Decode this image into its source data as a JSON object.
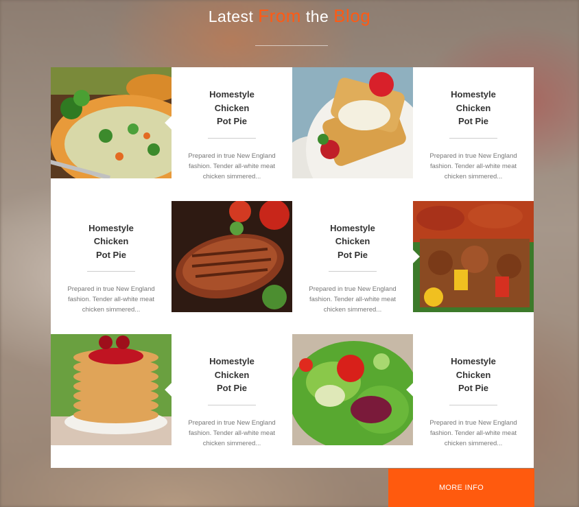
{
  "section": {
    "title_parts": [
      "Latest",
      "From",
      "the",
      "Blog"
    ]
  },
  "cards": [
    {
      "title_lines": [
        "Homestyle",
        "Chicken",
        "Pot Pie"
      ],
      "description": "Prepared in true New England fashion. Tender all-white meat chicken simmered...",
      "image": "chicken-pot-pie-bowl"
    },
    {
      "title_lines": [
        "Homestyle",
        "Chicken",
        "Pot Pie"
      ],
      "description": "Prepared in true New England fashion. Tender all-white meat chicken simmered...",
      "image": "waffles-strawberries"
    },
    {
      "title_lines": [
        "Homestyle",
        "Chicken",
        "Pot Pie"
      ],
      "description": "Prepared in true New England fashion. Tender all-white meat chicken simmered...",
      "image": "grilled-steak"
    },
    {
      "title_lines": [
        "Homestyle",
        "Chicken",
        "Pot Pie"
      ],
      "description": "Prepared in true New England fashion. Tender all-white meat chicken simmered...",
      "image": "sausage-kebabs"
    },
    {
      "title_lines": [
        "Homestyle",
        "Chicken",
        "Pot Pie"
      ],
      "description": "Prepared in true New England fashion. Tender all-white meat chicken simmered...",
      "image": "pancake-stack"
    },
    {
      "title_lines": [
        "Homestyle",
        "Chicken",
        "Pot Pie"
      ],
      "description": "Prepared in true New England fashion. Tender all-white meat chicken simmered...",
      "image": "green-salad"
    }
  ],
  "more_button": {
    "label": "MORE INFO"
  },
  "colors": {
    "accent": "#ff5a0e",
    "heading": "#ffffff",
    "title": "#333333",
    "text": "#777777"
  }
}
